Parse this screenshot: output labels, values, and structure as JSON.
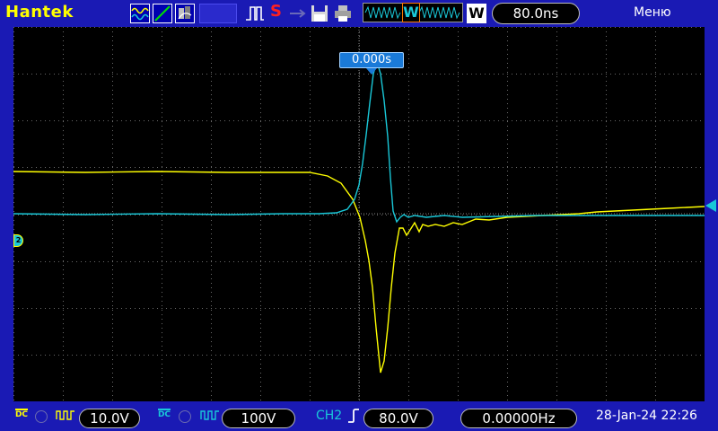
{
  "header": {
    "brand": "Hantek",
    "trigger_status": "S",
    "wave_marker": "W",
    "zoom_label": "W",
    "timebase": "80.0ns",
    "menu": "Меню"
  },
  "screen": {
    "trigger_position": "0.000s",
    "channel_marker": "2"
  },
  "footer": {
    "ch1_coupling": "DC",
    "ch1_scale": "10.0V",
    "ch2_coupling": "DC",
    "ch2_scale": "100V",
    "trigger_source": "CH2",
    "trigger_level": "80.0V",
    "frequency": "0.00000Hz",
    "datetime": "28-Jan-24 22:26"
  },
  "colors": {
    "ch1": "#ffff00",
    "ch2": "#19c8d8",
    "accent": "#1a1ab4",
    "trigger_badge": "#ff2020"
  },
  "icons": [
    "wave-icon",
    "slope-icon",
    "persist-icon",
    "pulse-icon",
    "usb-icon",
    "save-icon",
    "print-icon"
  ]
}
